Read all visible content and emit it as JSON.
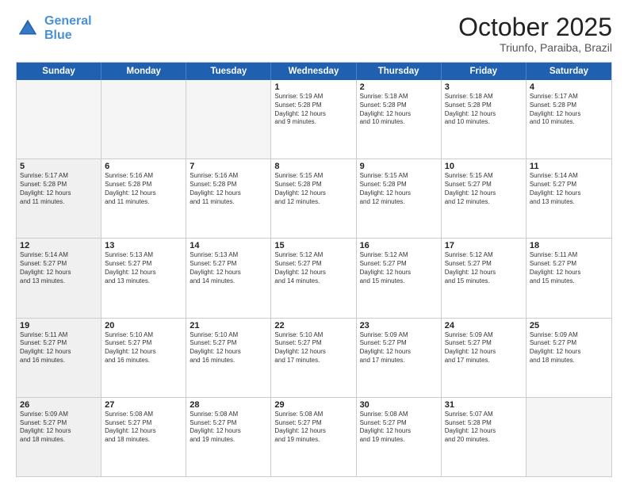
{
  "header": {
    "logo_line1": "General",
    "logo_line2": "Blue",
    "month": "October 2025",
    "location": "Triunfo, Paraiba, Brazil"
  },
  "weekdays": [
    "Sunday",
    "Monday",
    "Tuesday",
    "Wednesday",
    "Thursday",
    "Friday",
    "Saturday"
  ],
  "rows": [
    [
      {
        "day": "",
        "info": "",
        "empty": true
      },
      {
        "day": "",
        "info": "",
        "empty": true
      },
      {
        "day": "",
        "info": "",
        "empty": true
      },
      {
        "day": "1",
        "info": "Sunrise: 5:19 AM\nSunset: 5:28 PM\nDaylight: 12 hours\nand 9 minutes."
      },
      {
        "day": "2",
        "info": "Sunrise: 5:18 AM\nSunset: 5:28 PM\nDaylight: 12 hours\nand 10 minutes."
      },
      {
        "day": "3",
        "info": "Sunrise: 5:18 AM\nSunset: 5:28 PM\nDaylight: 12 hours\nand 10 minutes."
      },
      {
        "day": "4",
        "info": "Sunrise: 5:17 AM\nSunset: 5:28 PM\nDaylight: 12 hours\nand 10 minutes."
      }
    ],
    [
      {
        "day": "5",
        "info": "Sunrise: 5:17 AM\nSunset: 5:28 PM\nDaylight: 12 hours\nand 11 minutes."
      },
      {
        "day": "6",
        "info": "Sunrise: 5:16 AM\nSunset: 5:28 PM\nDaylight: 12 hours\nand 11 minutes."
      },
      {
        "day": "7",
        "info": "Sunrise: 5:16 AM\nSunset: 5:28 PM\nDaylight: 12 hours\nand 11 minutes."
      },
      {
        "day": "8",
        "info": "Sunrise: 5:15 AM\nSunset: 5:28 PM\nDaylight: 12 hours\nand 12 minutes."
      },
      {
        "day": "9",
        "info": "Sunrise: 5:15 AM\nSunset: 5:28 PM\nDaylight: 12 hours\nand 12 minutes."
      },
      {
        "day": "10",
        "info": "Sunrise: 5:15 AM\nSunset: 5:27 PM\nDaylight: 12 hours\nand 12 minutes."
      },
      {
        "day": "11",
        "info": "Sunrise: 5:14 AM\nSunset: 5:27 PM\nDaylight: 12 hours\nand 13 minutes."
      }
    ],
    [
      {
        "day": "12",
        "info": "Sunrise: 5:14 AM\nSunset: 5:27 PM\nDaylight: 12 hours\nand 13 minutes."
      },
      {
        "day": "13",
        "info": "Sunrise: 5:13 AM\nSunset: 5:27 PM\nDaylight: 12 hours\nand 13 minutes."
      },
      {
        "day": "14",
        "info": "Sunrise: 5:13 AM\nSunset: 5:27 PM\nDaylight: 12 hours\nand 14 minutes."
      },
      {
        "day": "15",
        "info": "Sunrise: 5:12 AM\nSunset: 5:27 PM\nDaylight: 12 hours\nand 14 minutes."
      },
      {
        "day": "16",
        "info": "Sunrise: 5:12 AM\nSunset: 5:27 PM\nDaylight: 12 hours\nand 15 minutes."
      },
      {
        "day": "17",
        "info": "Sunrise: 5:12 AM\nSunset: 5:27 PM\nDaylight: 12 hours\nand 15 minutes."
      },
      {
        "day": "18",
        "info": "Sunrise: 5:11 AM\nSunset: 5:27 PM\nDaylight: 12 hours\nand 15 minutes."
      }
    ],
    [
      {
        "day": "19",
        "info": "Sunrise: 5:11 AM\nSunset: 5:27 PM\nDaylight: 12 hours\nand 16 minutes."
      },
      {
        "day": "20",
        "info": "Sunrise: 5:10 AM\nSunset: 5:27 PM\nDaylight: 12 hours\nand 16 minutes."
      },
      {
        "day": "21",
        "info": "Sunrise: 5:10 AM\nSunset: 5:27 PM\nDaylight: 12 hours\nand 16 minutes."
      },
      {
        "day": "22",
        "info": "Sunrise: 5:10 AM\nSunset: 5:27 PM\nDaylight: 12 hours\nand 17 minutes."
      },
      {
        "day": "23",
        "info": "Sunrise: 5:09 AM\nSunset: 5:27 PM\nDaylight: 12 hours\nand 17 minutes."
      },
      {
        "day": "24",
        "info": "Sunrise: 5:09 AM\nSunset: 5:27 PM\nDaylight: 12 hours\nand 17 minutes."
      },
      {
        "day": "25",
        "info": "Sunrise: 5:09 AM\nSunset: 5:27 PM\nDaylight: 12 hours\nand 18 minutes."
      }
    ],
    [
      {
        "day": "26",
        "info": "Sunrise: 5:09 AM\nSunset: 5:27 PM\nDaylight: 12 hours\nand 18 minutes."
      },
      {
        "day": "27",
        "info": "Sunrise: 5:08 AM\nSunset: 5:27 PM\nDaylight: 12 hours\nand 18 minutes."
      },
      {
        "day": "28",
        "info": "Sunrise: 5:08 AM\nSunset: 5:27 PM\nDaylight: 12 hours\nand 19 minutes."
      },
      {
        "day": "29",
        "info": "Sunrise: 5:08 AM\nSunset: 5:27 PM\nDaylight: 12 hours\nand 19 minutes."
      },
      {
        "day": "30",
        "info": "Sunrise: 5:08 AM\nSunset: 5:27 PM\nDaylight: 12 hours\nand 19 minutes."
      },
      {
        "day": "31",
        "info": "Sunrise: 5:07 AM\nSunset: 5:28 PM\nDaylight: 12 hours\nand 20 minutes."
      },
      {
        "day": "",
        "info": "",
        "empty": true
      }
    ]
  ]
}
